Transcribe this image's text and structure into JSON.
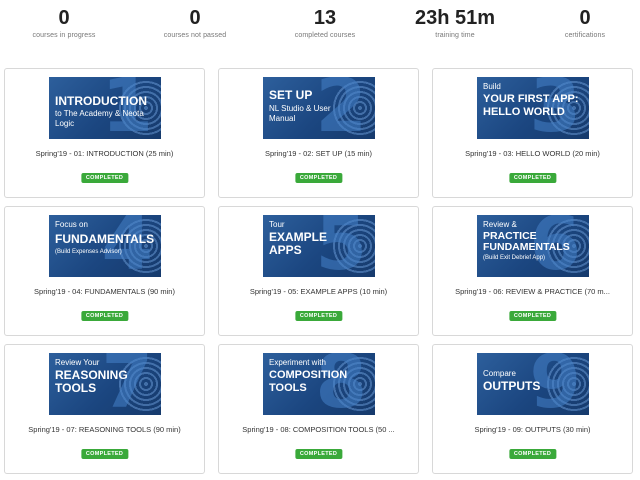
{
  "stats": [
    {
      "value": "0",
      "label": "courses in progress"
    },
    {
      "value": "0",
      "label": "courses not passed"
    },
    {
      "value": "13",
      "label": "completed courses"
    },
    {
      "value": "23h 51m",
      "label": "training time"
    },
    {
      "value": "0",
      "label": "certifications"
    }
  ],
  "courses": [
    {
      "title": "Spring'19 - 01: INTRODUCTION (25 min)",
      "status": "COMPLETED",
      "thumb": {
        "number": "1",
        "pre": "",
        "main": "INTRODUCTION",
        "sub": "to The Academy & Neota Logic"
      }
    },
    {
      "title": "Spring'19 - 02: SET UP (15 min)",
      "status": "COMPLETED",
      "thumb": {
        "number": "2",
        "pre": "",
        "main": "SET UP",
        "sub": "NL Studio & User Manual"
      }
    },
    {
      "title": "Spring'19 - 03: HELLO WORLD (20 min)",
      "status": "COMPLETED",
      "thumb": {
        "number": "3",
        "pre": "Build",
        "main": "YOUR FIRST APP: HELLO WORLD",
        "sub": ""
      }
    },
    {
      "title": "Spring'19 - 04: FUNDAMENTALS (90 min)",
      "status": "COMPLETED",
      "thumb": {
        "number": "4",
        "pre": "Focus on",
        "main": "FUNDAMENTALS",
        "sub": "(Build Expenses Advisor)"
      }
    },
    {
      "title": "Spring'19 - 05: EXAMPLE APPS (10 min)",
      "status": "COMPLETED",
      "thumb": {
        "number": "5",
        "pre": "Tour",
        "main": "EXAMPLE APPS",
        "sub": ""
      }
    },
    {
      "title": "Spring'19 - 06: REVIEW & PRACTICE (70 m...",
      "status": "COMPLETED",
      "thumb": {
        "number": "6",
        "pre": "Review &",
        "main": "PRACTICE FUNDAMENTALS",
        "sub": "(Build Exit Debrief App)"
      }
    },
    {
      "title": "Spring'19 - 07: REASONING TOOLS (90 min)",
      "status": "COMPLETED",
      "thumb": {
        "number": "7",
        "pre": "Review Your",
        "main": "REASONING TOOLS",
        "sub": ""
      }
    },
    {
      "title": "Spring'19 - 08: COMPOSITION TOOLS (50 ...",
      "status": "COMPLETED",
      "thumb": {
        "number": "8",
        "pre": "Experiment with",
        "main": "COMPOSITION TOOLS",
        "sub": ""
      }
    },
    {
      "title": "Spring'19 - 09: OUTPUTS (30 min)",
      "status": "COMPLETED",
      "thumb": {
        "number": "9",
        "pre": "Compare",
        "main": "OUTPUTS",
        "sub": ""
      }
    }
  ],
  "colors": {
    "badge": "#3aa93a",
    "thumb_bg": "#1b4680"
  }
}
